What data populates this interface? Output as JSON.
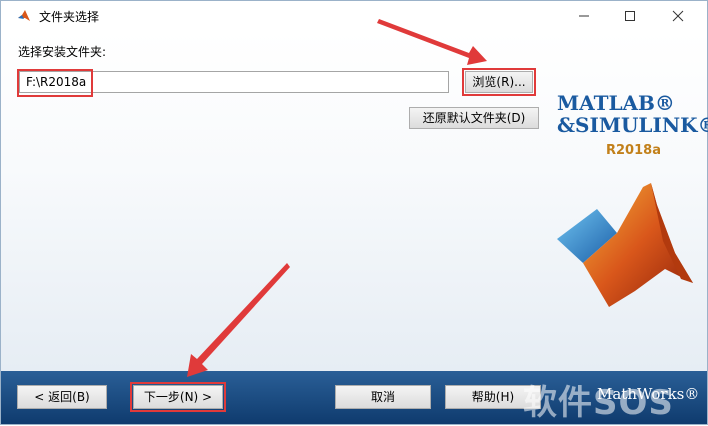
{
  "window": {
    "title": "文件夹选择"
  },
  "form": {
    "folder_label": "选择安装文件夹:",
    "folder_value": "F:\\R2018a",
    "browse_label": "浏览(R)...",
    "restore_label": "还原默认文件夹(D)"
  },
  "branding": {
    "matlab": "MATLAB®",
    "and_simulink": "&SIMULINK®",
    "version": "R2018a",
    "footer_logo": "MathWorks®",
    "watermark": "软件SOS"
  },
  "footer": {
    "back_label": "< 返回(B)",
    "next_label": "下一步(N) >",
    "cancel_label": "取消",
    "help_label": "帮助(H)"
  },
  "colors": {
    "highlight": "#e03a3a",
    "footer": "#1c4c83",
    "logo_blue": "#1a5aa0"
  }
}
